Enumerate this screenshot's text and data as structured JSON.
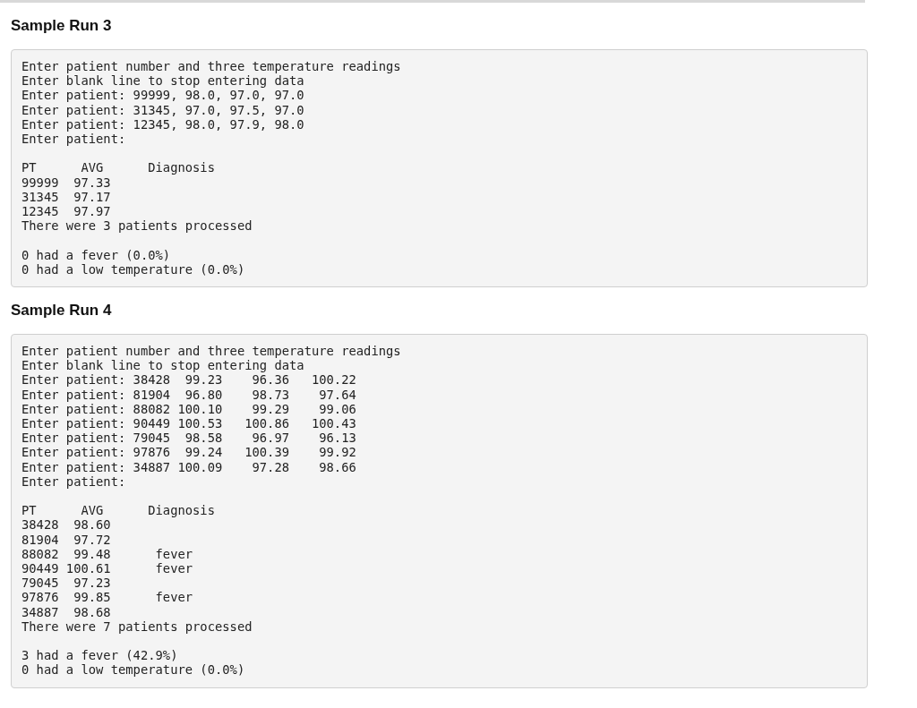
{
  "runs": [
    {
      "heading": "Sample Run 3",
      "groups": [
        [
          "Enter patient number and three temperature readings",
          "Enter blank line to stop entering data",
          "Enter patient: 99999, 98.0, 97.0, 97.0",
          "Enter patient: 31345, 97.0, 97.5, 97.0",
          "Enter patient: 12345, 98.0, 97.9, 98.0",
          "Enter patient:"
        ],
        [
          "PT      AVG      Diagnosis",
          "99999  97.33",
          "31345  97.17",
          "12345  97.97",
          "There were 3 patients processed"
        ],
        [
          "0 had a fever (0.0%)",
          "0 had a low temperature (0.0%)"
        ]
      ]
    },
    {
      "heading": "Sample Run 4",
      "groups": [
        [
          "Enter patient number and three temperature readings",
          "Enter blank line to stop entering data",
          "Enter patient: 38428  99.23    96.36   100.22",
          "Enter patient: 81904  96.80    98.73    97.64",
          "Enter patient: 88082 100.10    99.29    99.06",
          "Enter patient: 90449 100.53   100.86   100.43",
          "Enter patient: 79045  98.58    96.97    96.13",
          "Enter patient: 97876  99.24   100.39    99.92",
          "Enter patient: 34887 100.09    97.28    98.66",
          "Enter patient:"
        ],
        [
          "PT      AVG      Diagnosis",
          "38428  98.60",
          "81904  97.72",
          "88082  99.48      fever",
          "90449 100.61      fever",
          "79045  97.23",
          "97876  99.85      fever",
          "34887  98.68",
          "There were 7 patients processed"
        ],
        [
          "3 had a fever (42.9%)",
          "0 had a low temperature (0.0%)"
        ]
      ]
    }
  ]
}
